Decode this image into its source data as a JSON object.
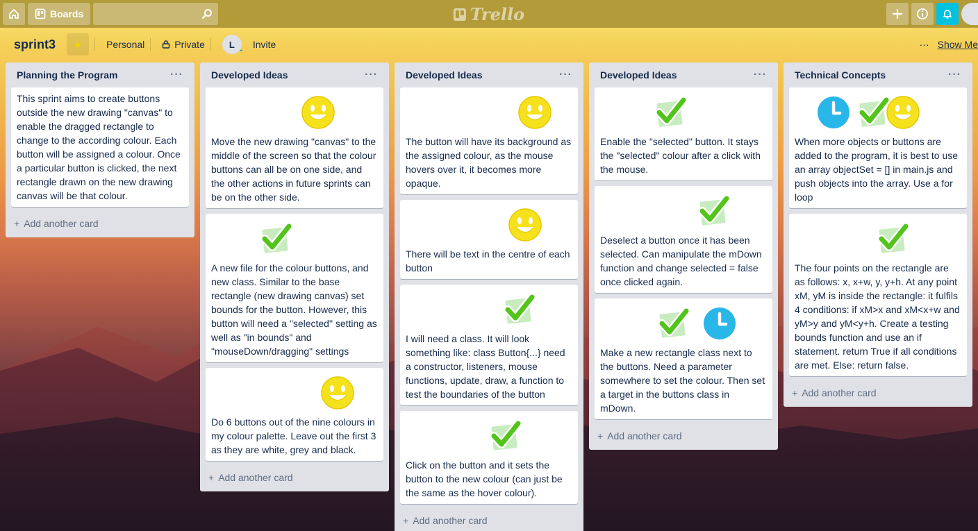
{
  "topbar": {
    "boards_label": "Boards",
    "search_placeholder": "",
    "logo_text": "Trello"
  },
  "board": {
    "title": "sprint3",
    "team": "Personal",
    "visibility": "Private",
    "member_initial": "L",
    "invite_label": "Invite",
    "show_menu_label": "Show Me"
  },
  "lists": [
    {
      "title": "Planning the Program",
      "add_label": "Add another card",
      "cards": [
        {
          "stickers": [],
          "text": "This sprint aims to create buttons outside the new drawing \"canvas\" to enable the dragged rectangle to change to the according colour. Each button will be assigned a colour. Once a particular button is clicked, the next rectangle drawn on the new drawing canvas will be that colour."
        }
      ]
    },
    {
      "title": "Developed Ideas",
      "add_label": "Add another card",
      "cards": [
        {
          "stickers": [
            "smiley"
          ],
          "text": "Move the new drawing \"canvas\" to the middle of the screen so that the colour buttons can all be on one side, and the other actions in future sprints can be on the other side."
        },
        {
          "stickers": [
            "check"
          ],
          "text": "A new file for the colour buttons, and new class. Similar to the base rectangle (new drawing canvas) set bounds for the button. However, this button will need a \"selected\" setting as well as \"in bounds\" and \"mouseDown/dragging\" settings"
        },
        {
          "stickers": [
            "smiley"
          ],
          "text": "Do 6 buttons out of the nine colours in my colour palette. Leave out the first 3 as they are white, grey and black."
        }
      ]
    },
    {
      "title": "Developed Ideas",
      "add_label": "Add another card",
      "cards": [
        {
          "stickers": [
            "smiley"
          ],
          "text": "The button will have its background as the assigned colour, as the mouse hovers over it, it becomes more opaque."
        },
        {
          "stickers": [
            "smiley"
          ],
          "text": "There will be text in the centre of each button"
        },
        {
          "stickers": [
            "check"
          ],
          "text": "I will need a class. It will look something like: class Button{...} need a constructor, listeners, mouse functions, update, draw, a function to test the boundaries of the button"
        },
        {
          "stickers": [
            "check"
          ],
          "text": "Click on the button and it sets the button to the new colour (can just be the same as the hover colour)."
        }
      ]
    },
    {
      "title": "Developed Ideas",
      "add_label": "Add another card",
      "cards": [
        {
          "stickers": [
            "check"
          ],
          "text": "Enable the \"selected\" button. It stays the \"selected\" colour after a click with the mouse."
        },
        {
          "stickers": [
            "check"
          ],
          "text": "Deselect a button once it has been selected. Can manipulate the mDown function and change selected = false once clicked again."
        },
        {
          "stickers": [
            "check",
            "clock"
          ],
          "text": "Make a new rectangle class next to the buttons. Need a parameter somewhere to set the colour. Then set a target in the buttons class in mDown."
        }
      ]
    },
    {
      "title": "Technical Concepts",
      "add_label": "Add another card",
      "cards": [
        {
          "stickers": [
            "clock",
            "check",
            "smiley"
          ],
          "text": "When more objects or buttons are added to the program, it is best to use an array objectSet = [] in main.js and push objects into the array. Use a for loop"
        },
        {
          "stickers": [
            "check"
          ],
          "text": "The four points on the rectangle are as follows: x, x+w, y, y+h. At any point xM, yM is inside the rectangle: it fulfils 4 conditions: if xM>x and xM<x+w and yM>y and yM<y+h. Create a testing bounds function and use an if statement. return True if all conditions are met. Else: return false."
        }
      ]
    }
  ]
}
